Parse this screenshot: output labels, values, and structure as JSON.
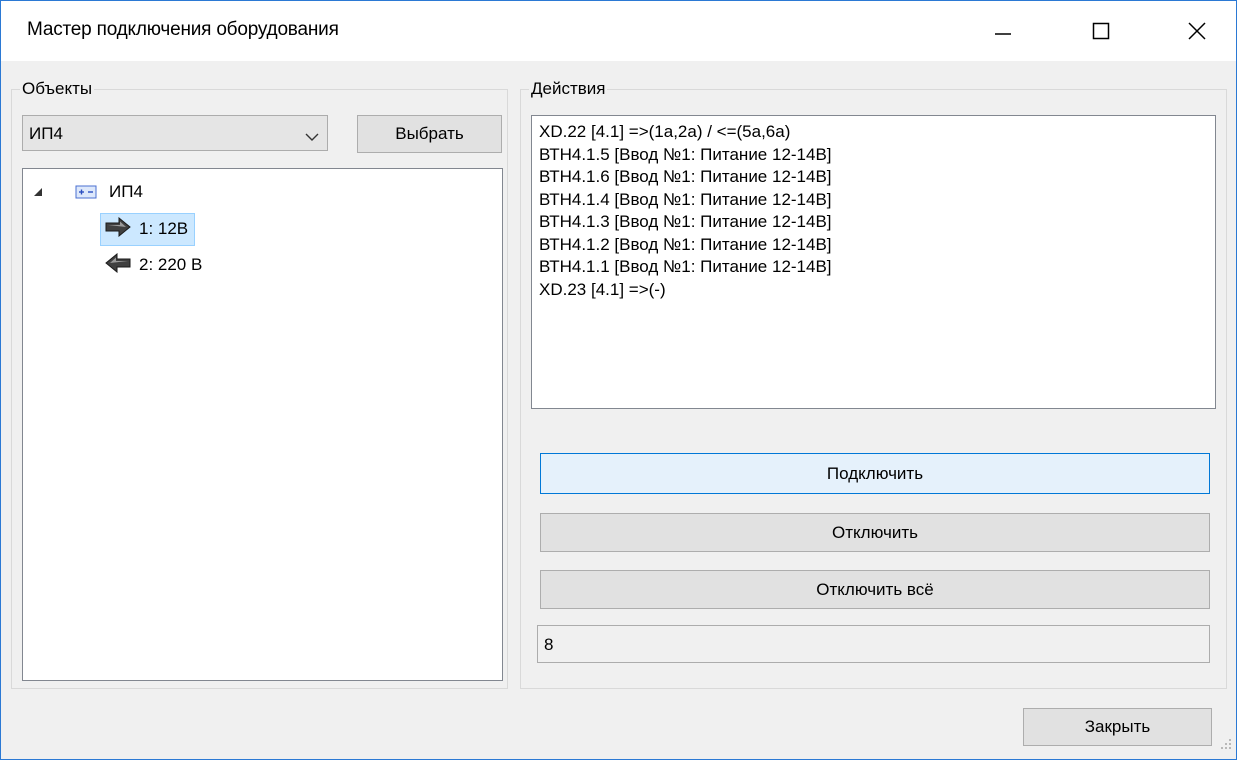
{
  "window": {
    "title": "Мастер подключения оборудования",
    "caption_buttons": [
      "minimize-icon",
      "maximize-icon",
      "close-icon"
    ]
  },
  "objects_group": {
    "label": "Объекты",
    "combo_value": "ИП4",
    "select_button": "Выбрать",
    "tree": {
      "root": {
        "label": "ИП4",
        "icon": "device-icon",
        "expanded": true
      },
      "children": [
        {
          "label": "1: 12В",
          "icon": "arrow-right-icon",
          "selected": true
        },
        {
          "label": "2: 220 В",
          "icon": "arrow-left-icon",
          "selected": false
        }
      ]
    }
  },
  "actions_group": {
    "label": "Действия",
    "items": [
      "XD.22 [4.1] =>(1a,2a) / <=(5a,6a)",
      "ВТН4.1.5 [Ввод №1: Питание 12-14В]",
      "ВТН4.1.6 [Ввод №1: Питание 12-14В]",
      "ВТН4.1.4 [Ввод №1: Питание 12-14В]",
      "ВТН4.1.3 [Ввод №1: Питание 12-14В]",
      "ВТН4.1.2 [Ввод №1: Питание 12-14В]",
      "ВТН4.1.1 [Ввод №1: Питание 12-14В]",
      "XD.23 [4.1] =>(-)"
    ],
    "connect_button": "Подключить",
    "disconnect_button": "Отключить",
    "disconnect_all_button": "Отключить всё",
    "count_value": "8"
  },
  "footer": {
    "close_button": "Закрыть"
  },
  "colors": {
    "window_border": "#2b79d4",
    "selection_bg": "#cce8ff",
    "default_button_border": "#0078d7"
  }
}
